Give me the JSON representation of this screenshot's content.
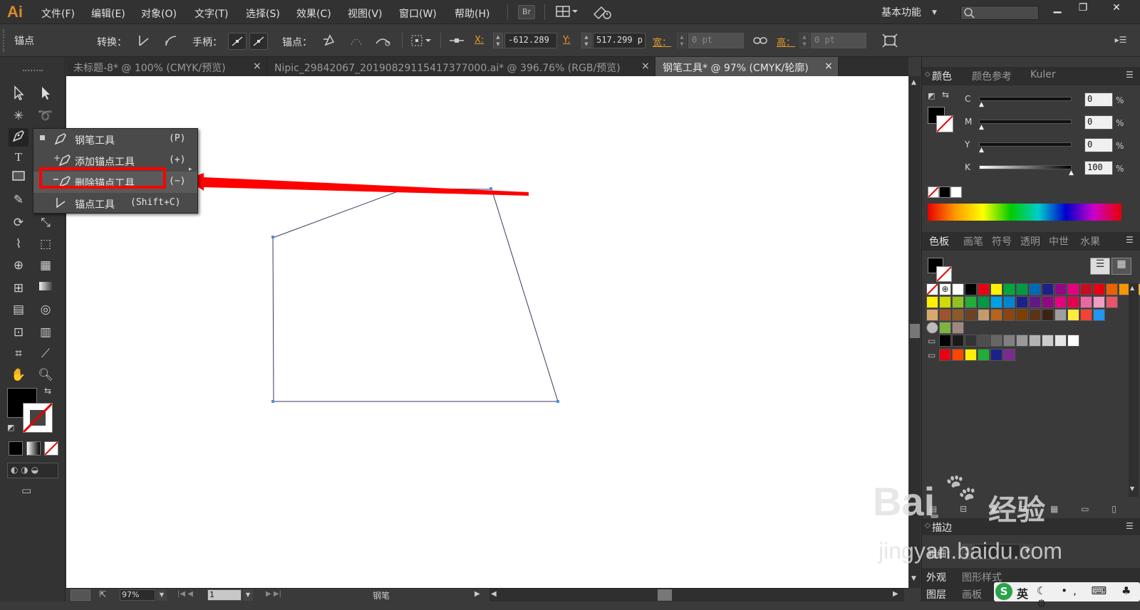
{
  "app": {
    "logo": "Ai"
  },
  "menubar": {
    "items": [
      "文件(F)",
      "编辑(E)",
      "对象(O)",
      "文字(T)",
      "选择(S)",
      "效果(C)",
      "视图(V)",
      "窗口(W)",
      "帮助(H)"
    ],
    "br_button": "Br",
    "workspace": "基本功能",
    "search_placeholder": ""
  },
  "control": {
    "mode_label": "锚点",
    "convert_label": "转换：",
    "handles_label": "手柄：",
    "anchors_label": "锚点：",
    "x_label": "X:",
    "x_value": "-612.289",
    "y_label": "Y:",
    "y_value": "517.299 p",
    "w_label": "宽：",
    "w_value": "0 pt",
    "h_label": "高：",
    "h_value": "0 pt"
  },
  "tabs": [
    {
      "label": "未标题-8* @ 100% (CMYK/预览)",
      "close": "×"
    },
    {
      "label": "Nipic_29842067_20190829115417377000.ai* @ 396.76% (RGB/预览)",
      "close": "×"
    },
    {
      "label": "钢笔工具* @ 97% (CMYK/轮廓)",
      "close": "×"
    }
  ],
  "flyout": {
    "items": [
      {
        "label": "钢笔工具",
        "shortcut": "(P)",
        "icon": "pen-icon"
      },
      {
        "label": "添加锚点工具",
        "shortcut": "(+)",
        "icon": "add-anchor-icon"
      },
      {
        "label": "删除锚点工具",
        "shortcut": "(−)",
        "icon": "delete-anchor-icon"
      },
      {
        "label": "锚点工具",
        "shortcut": "(Shift+C)",
        "icon": "anchor-point-icon"
      }
    ]
  },
  "status": {
    "zoom": "97%",
    "artboard": "1",
    "tool": "钢笔"
  },
  "color_panel": {
    "tabs": [
      "颜色",
      "颜色参考",
      "Kuler"
    ],
    "channels": [
      {
        "name": "C",
        "value": "0",
        "unit": "%",
        "level": 0
      },
      {
        "name": "M",
        "value": "0",
        "unit": "%",
        "level": 0
      },
      {
        "name": "Y",
        "value": "0",
        "unit": "%",
        "level": 0
      },
      {
        "name": "K",
        "value": "100",
        "unit": "%",
        "level": 1
      }
    ]
  },
  "swatches_panel": {
    "tabs": [
      "色板",
      "画笔",
      "符号",
      "透明",
      "中世",
      "水果"
    ],
    "row1": [
      "#ffffff",
      "#000000",
      "#e60012",
      "#fff100",
      "#00a73c",
      "#009944",
      "#0068b7",
      "#1d2088",
      "#920783",
      "#e4007f",
      "#c30d23",
      "#e60012",
      "#eb6100",
      "#f39800",
      "#f8b62d"
    ],
    "row2": [
      "#fff100",
      "#cfdb00",
      "#8fc31f",
      "#22ac38",
      "#009944",
      "#00a0e9",
      "#0086d1",
      "#1d2088",
      "#601986",
      "#920783",
      "#e4007f",
      "#e5004f",
      "#ea68a2",
      "#f19ec2",
      "#e9546b"
    ],
    "row3": [
      "#d7a86e",
      "#a0522d",
      "#8b5a2b",
      "#6b4226",
      "#c49a6c",
      "#b5651d",
      "#8b4513",
      "#7b3f00",
      "#5c3317",
      "#3b2314",
      "#9e9e9e",
      "#ffeb3b",
      "#f44336",
      "#2196f3"
    ],
    "grays": [
      "#000000",
      "#1a1a1a",
      "#333333",
      "#4d4d4d",
      "#666666",
      "#808080",
      "#999999",
      "#b3b3b3",
      "#cccccc",
      "#e6e6e6",
      "#ffffff"
    ],
    "group2": [
      "#e60012",
      "#ff4500",
      "#fff100",
      "#22ac38",
      "#1d2088",
      "#7b2b8f"
    ]
  },
  "stroke_panel": {
    "label": "描边",
    "weight_label": "粗细："
  },
  "appearance_panel": {
    "tabs": [
      "外观",
      "图形样式"
    ]
  },
  "layers_panel": {
    "tabs": [
      "图层",
      "画板"
    ]
  },
  "watermark": {
    "brand": "Bai",
    "suffix": "经验",
    "url": "jingyan.baidu.com"
  },
  "ime": {
    "mode": "英"
  },
  "colors": {
    "accent": "#e60000",
    "orange": "#e69a2b",
    "bg": "#3a3a3a"
  }
}
